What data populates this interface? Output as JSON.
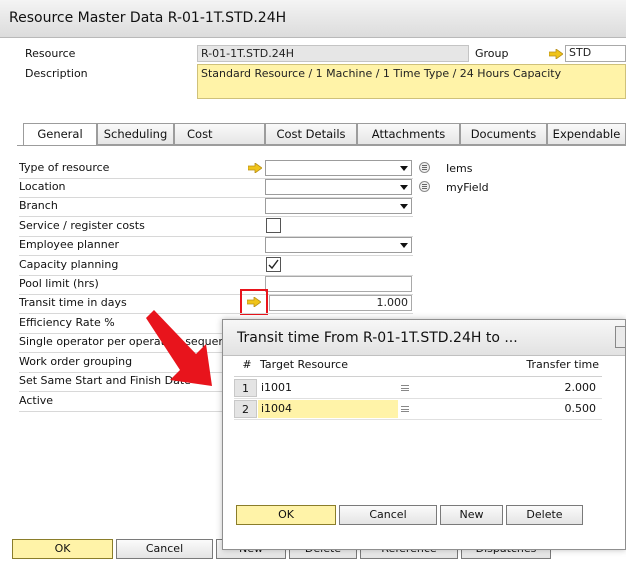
{
  "window": {
    "title": "Resource Master Data R-01-1T.STD.24H"
  },
  "header": {
    "resource_label": "Resource",
    "resource_value": "R-01-1T.STD.24H",
    "group_label": "Group",
    "group_value": "STD",
    "description_label": "Description",
    "description_value": "Standard Resource / 1 Machine / 1 Time Type / 24 Hours Capacity"
  },
  "tabs": [
    {
      "label": "General",
      "active": true
    },
    {
      "label": "Scheduling",
      "active": false
    },
    {
      "label": "Cost",
      "active": false
    },
    {
      "label": "Cost Details",
      "active": false
    },
    {
      "label": "Attachments",
      "active": false
    },
    {
      "label": "Documents",
      "active": false
    },
    {
      "label": "Expendable",
      "active": false
    }
  ],
  "general": {
    "type_of_resource_label": "Type of resource",
    "location_label": "Location",
    "branch_label": "Branch",
    "service_register_label": "Service / register costs",
    "employee_planner_label": "Employee planner",
    "capacity_planning_label": "Capacity planning",
    "capacity_planning_checked": true,
    "pool_limit_label": "Pool limit (hrs)",
    "transit_time_label": "Transit time in days",
    "transit_time_value": "1.000",
    "efficiency_rate_label": "Efficiency Rate %",
    "single_operator_label": "Single operator per operation sequence",
    "work_order_grouping_label": "Work order grouping",
    "same_start_finish_label": "Set Same Start and Finish Date",
    "active_label": "Active",
    "iems_label": "Iems",
    "myfield_label": "myField"
  },
  "footer_buttons": {
    "ok": "OK",
    "cancel": "Cancel",
    "new": "New",
    "delete": "Delete",
    "reference": "Reference",
    "dispatches": "Dispatches"
  },
  "dialog": {
    "title": "Transit time From R-01-1T.STD.24H to ...",
    "columns": {
      "num": "#",
      "target": "Target Resource",
      "transfer": "Transfer time"
    },
    "rows": [
      {
        "num": "1",
        "target": "i1001",
        "transfer": "2.000"
      },
      {
        "num": "2",
        "target": "i1004",
        "transfer": "0.500"
      }
    ],
    "buttons": {
      "ok": "OK",
      "cancel": "Cancel",
      "new": "New",
      "delete": "Delete"
    }
  },
  "colors": {
    "highlight_yellow": "#fff3a8",
    "annotation_red": "#e8141c",
    "link_arrow": "#f0c419"
  }
}
